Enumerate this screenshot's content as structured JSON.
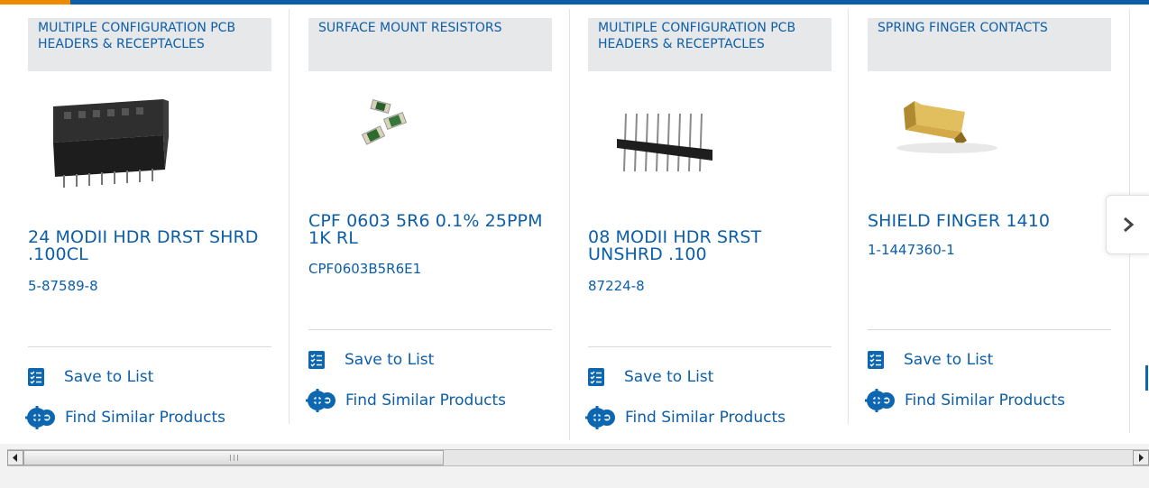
{
  "colors": {
    "accent": "#0d5ea8",
    "accent_orange": "#ef8a00",
    "category_bg": "#e7e8e9"
  },
  "carousel": {
    "next_icon": "chevron-right-icon",
    "products": [
      {
        "category": "MULTIPLE CONFIGURATION PCB HEADERS & RECEPTACLES",
        "image": "pcb-header-shrouded",
        "title": "24 MODII HDR DRST SHRD .100CL",
        "part_number": "5-87589-8",
        "save_label": "Save to List",
        "similar_label": "Find Similar Products"
      },
      {
        "category": "SURFACE MOUNT RESISTORS",
        "image": "smd-resistors",
        "title": "CPF 0603 5R6 0.1% 25PPM 1K RL",
        "part_number": "CPF0603B5R6E1",
        "save_label": "Save to List",
        "similar_label": "Find Similar Products"
      },
      {
        "category": "MULTIPLE CONFIGURATION PCB HEADERS & RECEPTACLES",
        "image": "pin-header-unshrouded",
        "title": "08 MODII HDR SRST UNSHRD .100",
        "part_number": "87224-8",
        "save_label": "Save to List",
        "similar_label": "Find Similar Products"
      },
      {
        "category": "SPRING FINGER CONTACTS",
        "image": "shield-finger-contact",
        "title": "SHIELD FINGER 1410",
        "part_number": "1-1447360-1",
        "save_label": "Save to List",
        "similar_label": "Find Similar Products"
      }
    ]
  },
  "scrollbar": {
    "left_icon": "arrow-left-icon",
    "right_icon": "arrow-right-icon",
    "position": 0.39
  }
}
